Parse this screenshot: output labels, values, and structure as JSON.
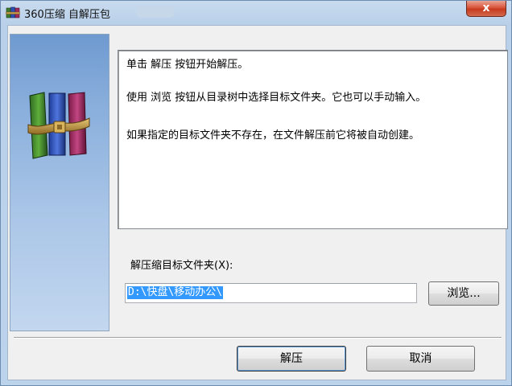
{
  "window": {
    "title": "360压缩 自解压包",
    "close_symbol": "x"
  },
  "side_panel": {
    "icon": "books-archive-icon"
  },
  "info": {
    "lines": [
      "单击 解压 按钮开始解压。",
      "使用 浏览 按钮从目录树中选择目标文件夹。它也可以手动输入。",
      "如果指定的目标文件夹不存在，在文件解压前它将被自动创建。"
    ]
  },
  "destination": {
    "label": "解压缩目标文件夹(X):",
    "value": "D:\\快盘\\移动办公\\",
    "browse_label": "浏览..."
  },
  "buttons": {
    "extract_label": "解压",
    "cancel_label": "取消"
  },
  "colors": {
    "selection": "#3399ff",
    "close_button": "#c63a1e",
    "panel_gradient_top": "#6f9ad0"
  }
}
